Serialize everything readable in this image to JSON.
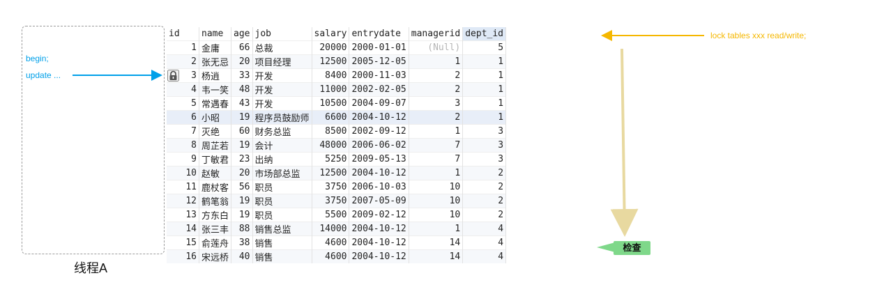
{
  "thread": {
    "lines": [
      "begin;",
      "update ..."
    ],
    "label": "线程A"
  },
  "table": {
    "columns": [
      "id",
      "name",
      "age",
      "job",
      "salary",
      "entrydate",
      "managerid",
      "dept_id"
    ],
    "selected_column": "dept_id",
    "rows": [
      [
        "1",
        "金庸",
        "66",
        "总裁",
        "20000",
        "2000-01-01",
        "(Null)",
        "5"
      ],
      [
        "2",
        "张无忌",
        "20",
        "项目经理",
        "12500",
        "2005-12-05",
        "1",
        "1"
      ],
      [
        "3",
        "杨逍",
        "33",
        "开发",
        "8400",
        "2000-11-03",
        "2",
        "1"
      ],
      [
        "4",
        "韦一笑",
        "48",
        "开发",
        "11000",
        "2002-02-05",
        "2",
        "1"
      ],
      [
        "5",
        "常遇春",
        "43",
        "开发",
        "10500",
        "2004-09-07",
        "3",
        "1"
      ],
      [
        "6",
        "小昭",
        "19",
        "程序员鼓励师",
        "6600",
        "2004-10-12",
        "2",
        "1"
      ],
      [
        "7",
        "灭绝",
        "60",
        "财务总监",
        "8500",
        "2002-09-12",
        "1",
        "3"
      ],
      [
        "8",
        "周芷若",
        "19",
        "会计",
        "48000",
        "2006-06-02",
        "7",
        "3"
      ],
      [
        "9",
        "丁敏君",
        "23",
        "出纳",
        "5250",
        "2009-05-13",
        "7",
        "3"
      ],
      [
        "10",
        "赵敏",
        "20",
        "市场部总监",
        "12500",
        "2004-10-12",
        "1",
        "2"
      ],
      [
        "11",
        "鹿杖客",
        "56",
        "职员",
        "3750",
        "2006-10-03",
        "10",
        "2"
      ],
      [
        "12",
        "鹤笔翁",
        "19",
        "职员",
        "3750",
        "2007-05-09",
        "10",
        "2"
      ],
      [
        "13",
        "方东白",
        "19",
        "职员",
        "5500",
        "2009-02-12",
        "10",
        "2"
      ],
      [
        "14",
        "张三丰",
        "88",
        "销售总监",
        "14000",
        "2004-10-12",
        "1",
        "4"
      ],
      [
        "15",
        "俞莲舟",
        "38",
        "销售",
        "4600",
        "2004-10-12",
        "14",
        "4"
      ],
      [
        "16",
        "宋远桥",
        "40",
        "销售",
        "4600",
        "2004-10-12",
        "14",
        "4"
      ]
    ],
    "locked_row_index": 2
  },
  "annotations": {
    "lock_text": "lock tables xxx read/write;",
    "check_label": "检查"
  },
  "colors": {
    "thread_arrow": "#00a0e9",
    "lock_arrow": "#f5b700",
    "scan_arrow": "#e8d9a0",
    "check_bg": "#7fd88a"
  }
}
